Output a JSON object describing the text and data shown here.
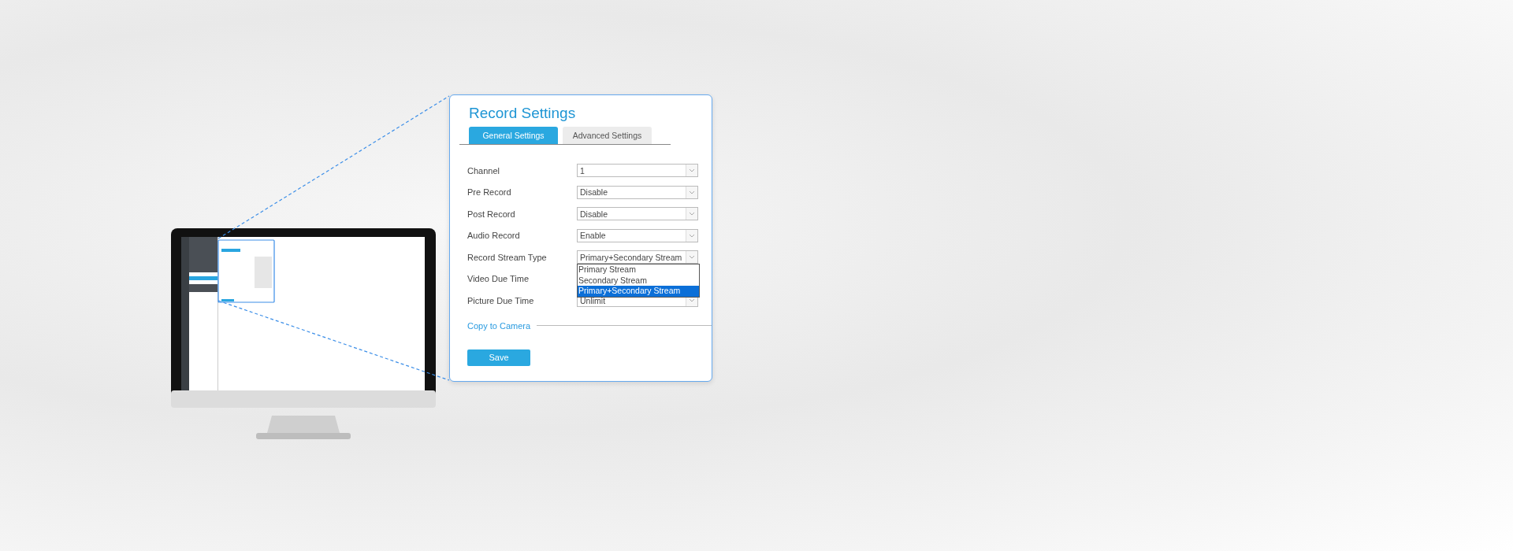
{
  "panel": {
    "title": "Record Settings",
    "tabs": [
      {
        "label": "General Settings",
        "selected": true
      },
      {
        "label": "Advanced Settings",
        "selected": false
      }
    ],
    "fields": [
      {
        "label": "Channel",
        "value": "1"
      },
      {
        "label": "Pre Record",
        "value": "Disable"
      },
      {
        "label": "Post Record",
        "value": "Disable"
      },
      {
        "label": "Audio Record",
        "value": "Enable"
      },
      {
        "label": "Record Stream Type",
        "value": "Primary+Secondary Stream",
        "options": [
          {
            "label": "Primary Stream",
            "selected": false
          },
          {
            "label": "Secondary Stream",
            "selected": false
          },
          {
            "label": "Primary+Secondary Stream",
            "selected": true
          }
        ]
      },
      {
        "label": "Video Due Time"
      },
      {
        "label": "Picture Due Time",
        "value": "Unlimit"
      }
    ],
    "copy_link": "Copy to Camera",
    "save_button": "Save"
  }
}
